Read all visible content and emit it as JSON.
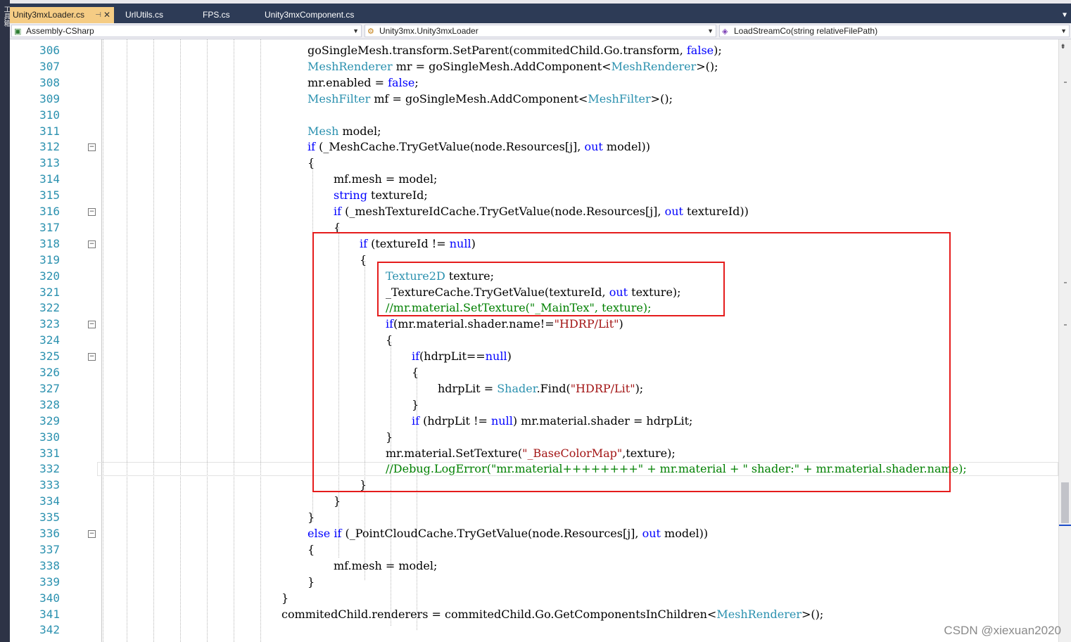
{
  "left_strip_text": "工具箱",
  "tabs": [
    {
      "label": "Unity3mxLoader.cs",
      "active": true
    },
    {
      "label": "UrlUtils.cs",
      "active": false
    },
    {
      "label": "FPS.cs",
      "active": false
    },
    {
      "label": "Unity3mxComponent.cs",
      "active": false
    }
  ],
  "navbar": {
    "project": "Assembly-CSharp",
    "type": "Unity3mx.Unity3mxLoader",
    "member": "LoadStreamCo(string relativeFilePath)"
  },
  "icons": {
    "pin": "pin-icon",
    "close": "close-icon",
    "project": "csharp-project-icon",
    "class": "class-icon",
    "method": "method-icon",
    "dropdown": "chevron-down-icon"
  },
  "colors": {
    "keyword": "#0000ff",
    "type": "#2b91af",
    "string": "#a31515",
    "comment": "#008000",
    "line_number": "#2b91af",
    "highlight_box": "#e51c1c",
    "active_tab": "#f5cc84"
  },
  "lines": [
    {
      "n": "306",
      "indent": 1,
      "code": [
        [
          "goSingleMesh.transform.SetParent(commitedChild.Go.transform, ",
          ""
        ],
        [
          "false",
          "kw"
        ],
        [
          ");",
          ""
        ]
      ]
    },
    {
      "n": "307",
      "indent": 1,
      "code": [
        [
          "MeshRenderer",
          "ty"
        ],
        [
          " mr = goSingleMesh.AddComponent<",
          ""
        ],
        [
          "MeshRenderer",
          "ty"
        ],
        [
          ">();",
          ""
        ]
      ]
    },
    {
      "n": "308",
      "indent": 1,
      "code": [
        [
          "mr.enabled = ",
          ""
        ],
        [
          "false",
          "kw"
        ],
        [
          ";",
          ""
        ]
      ]
    },
    {
      "n": "309",
      "indent": 1,
      "code": [
        [
          "MeshFilter",
          "ty"
        ],
        [
          " mf = goSingleMesh.AddComponent<",
          ""
        ],
        [
          "MeshFilter",
          "ty"
        ],
        [
          ">();",
          ""
        ]
      ]
    },
    {
      "n": "310",
      "indent": 1,
      "code": []
    },
    {
      "n": "311",
      "indent": 1,
      "code": [
        [
          "Mesh",
          "ty"
        ],
        [
          " model;",
          ""
        ]
      ]
    },
    {
      "n": "312",
      "indent": 1,
      "fold": true,
      "code": [
        [
          "if",
          "kw"
        ],
        [
          " (_MeshCache.TryGetValue(node.Resources[j], ",
          ""
        ],
        [
          "out",
          "kw"
        ],
        [
          " model))",
          ""
        ]
      ]
    },
    {
      "n": "313",
      "indent": 1,
      "code": [
        [
          "{",
          ""
        ]
      ]
    },
    {
      "n": "314",
      "indent": 2,
      "code": [
        [
          "mf.mesh = model;",
          ""
        ]
      ]
    },
    {
      "n": "315",
      "indent": 2,
      "code": [
        [
          "string",
          "kw"
        ],
        [
          " textureId;",
          ""
        ]
      ]
    },
    {
      "n": "316",
      "indent": 2,
      "fold": true,
      "code": [
        [
          "if",
          "kw"
        ],
        [
          " (_meshTextureIdCache.TryGetValue(node.Resources[j], ",
          ""
        ],
        [
          "out",
          "kw"
        ],
        [
          " textureId))",
          ""
        ]
      ]
    },
    {
      "n": "317",
      "indent": 2,
      "code": [
        [
          "{",
          ""
        ]
      ]
    },
    {
      "n": "318",
      "indent": 3,
      "fold": true,
      "code": [
        [
          "if",
          "kw"
        ],
        [
          " (textureId != ",
          ""
        ],
        [
          "null",
          "kw"
        ],
        [
          ")",
          ""
        ]
      ]
    },
    {
      "n": "319",
      "indent": 3,
      "code": [
        [
          "{",
          ""
        ]
      ]
    },
    {
      "n": "320",
      "indent": 4,
      "code": [
        [
          "Texture2D",
          "ty"
        ],
        [
          " texture;",
          ""
        ]
      ]
    },
    {
      "n": "321",
      "indent": 4,
      "code": [
        [
          "_TextureCache.TryGetValue(textureId, ",
          ""
        ],
        [
          "out",
          "kw"
        ],
        [
          " texture);",
          ""
        ]
      ]
    },
    {
      "n": "322",
      "indent": 4,
      "code": [
        [
          "//mr.material.SetTexture(\"_MainTex\", texture);",
          "cm"
        ]
      ]
    },
    {
      "n": "323",
      "indent": 4,
      "fold": true,
      "code": [
        [
          "if",
          "kw"
        ],
        [
          "(mr.material.shader.name!=",
          ""
        ],
        [
          "\"HDRP/Lit\"",
          "str"
        ],
        [
          ")",
          ""
        ]
      ]
    },
    {
      "n": "324",
      "indent": 4,
      "code": [
        [
          "{",
          ""
        ]
      ]
    },
    {
      "n": "325",
      "indent": 5,
      "fold": true,
      "code": [
        [
          "if",
          "kw"
        ],
        [
          "(hdrpLit==",
          ""
        ],
        [
          "null",
          "kw"
        ],
        [
          ")",
          ""
        ]
      ]
    },
    {
      "n": "326",
      "indent": 5,
      "code": [
        [
          "{",
          ""
        ]
      ]
    },
    {
      "n": "327",
      "indent": 6,
      "code": [
        [
          "hdrpLit = ",
          ""
        ],
        [
          "Shader",
          "ty"
        ],
        [
          ".Find(",
          ""
        ],
        [
          "\"HDRP/Lit\"",
          "str"
        ],
        [
          ");",
          ""
        ]
      ]
    },
    {
      "n": "328",
      "indent": 5,
      "code": [
        [
          "}",
          ""
        ]
      ]
    },
    {
      "n": "329",
      "indent": 5,
      "code": [
        [
          "if",
          "kw"
        ],
        [
          " (hdrpLit != ",
          ""
        ],
        [
          "null",
          "kw"
        ],
        [
          ") mr.material.shader = hdrpLit;",
          ""
        ]
      ]
    },
    {
      "n": "330",
      "indent": 4,
      "code": [
        [
          "}",
          ""
        ]
      ]
    },
    {
      "n": "331",
      "indent": 4,
      "code": [
        [
          "mr.material.SetTexture(",
          ""
        ],
        [
          "\"_BaseColorMap\"",
          "str"
        ],
        [
          ",texture);",
          ""
        ]
      ]
    },
    {
      "n": "332",
      "indent": 4,
      "code": [
        [
          "//Debug.LogError(\"mr.material++++++++\" + mr.material + \" shader:\" + mr.material.shader.name);",
          "cm"
        ]
      ]
    },
    {
      "n": "333",
      "indent": 3,
      "code": [
        [
          "}",
          ""
        ]
      ]
    },
    {
      "n": "334",
      "indent": 2,
      "code": [
        [
          "}",
          ""
        ]
      ]
    },
    {
      "n": "335",
      "indent": 1,
      "code": [
        [
          "}",
          ""
        ]
      ]
    },
    {
      "n": "336",
      "indent": 1,
      "fold": true,
      "code": [
        [
          "else",
          "kw"
        ],
        [
          " ",
          ""
        ],
        [
          "if",
          "kw"
        ],
        [
          " (_PointCloudCache.TryGetValue(node.Resources[j], ",
          ""
        ],
        [
          "out",
          "kw"
        ],
        [
          " model))",
          ""
        ]
      ]
    },
    {
      "n": "337",
      "indent": 1,
      "code": [
        [
          "{",
          ""
        ]
      ]
    },
    {
      "n": "338",
      "indent": 2,
      "code": [
        [
          "mf.mesh = model;",
          ""
        ]
      ]
    },
    {
      "n": "339",
      "indent": 1,
      "code": [
        [
          "}",
          ""
        ]
      ]
    },
    {
      "n": "340",
      "indent": 0,
      "code": [
        [
          "}",
          ""
        ]
      ]
    },
    {
      "n": "341",
      "indent": 0,
      "code": [
        [
          "commitedChild.renderers = commitedChild.Go.GetComponentsInChildren<",
          ""
        ],
        [
          "MeshRenderer",
          "ty"
        ],
        [
          ">();",
          ""
        ]
      ]
    },
    {
      "n": "342",
      "indent": 0,
      "code": []
    }
  ],
  "watermark": "CSDN @xiexuan2020"
}
